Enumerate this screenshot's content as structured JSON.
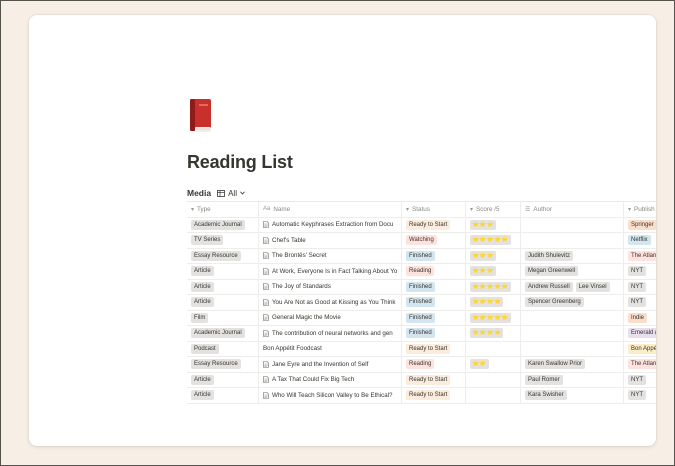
{
  "page": {
    "title": "Reading List",
    "icon": "red-book-icon"
  },
  "database": {
    "title": "Media",
    "view_label": "All"
  },
  "columns": [
    {
      "label": "Type",
      "icon": "select-icon"
    },
    {
      "label": "Name",
      "icon": "text-icon"
    },
    {
      "label": "Status",
      "icon": "select-icon"
    },
    {
      "label": "Score /5",
      "icon": "select-icon"
    },
    {
      "label": "Author",
      "icon": "multi-select-icon"
    },
    {
      "label": "Publish",
      "icon": "select-icon"
    }
  ],
  "rows": [
    {
      "type": "Academic Journal",
      "name": "Automatic Keyphrases Extraction from Docu",
      "status": "Ready to Start",
      "status_class": "st-ready",
      "score": "⭐⭐⭐",
      "authors": [],
      "publisher": "Springer",
      "pub_class": "pub-springer",
      "doc": true
    },
    {
      "type": "TV Series",
      "name": "Chef's Table",
      "status": "Watching",
      "status_class": "st-watching",
      "score": "⭐⭐⭐⭐⭐",
      "authors": [],
      "publisher": "Netflix",
      "pub_class": "pub-netflix",
      "doc": true
    },
    {
      "type": "Essay Resource",
      "name": "The Brontës' Secret",
      "status": "Finished",
      "status_class": "st-finished",
      "score": "⭐⭐⭐",
      "authors": [
        "Judith Shulevitz"
      ],
      "publisher": "The Atlan",
      "pub_class": "pub-atlantic",
      "doc": true
    },
    {
      "type": "Article",
      "name": "At Work, Everyone Is in Fact Talking About Yo",
      "status": "Reading",
      "status_class": "st-reading",
      "score": "⭐⭐⭐",
      "authors": [
        "Megan Greenwell"
      ],
      "publisher": "NYT",
      "pub_class": "pub-nyt",
      "doc": true
    },
    {
      "type": "Article",
      "name": "The Joy of Standards",
      "status": "Finished",
      "status_class": "st-finished",
      "score": "⭐⭐⭐⭐⭐",
      "authors": [
        "Andrew Russell",
        "Lee Vinsel"
      ],
      "publisher": "NYT",
      "pub_class": "pub-nyt",
      "doc": true
    },
    {
      "type": "Article",
      "name": "You Are Not as Good at Kissing as You Think",
      "status": "Finished",
      "status_class": "st-finished",
      "score": "⭐⭐⭐⭐",
      "authors": [
        "Spencer Greenberg"
      ],
      "publisher": "NYT",
      "pub_class": "pub-nyt",
      "doc": true
    },
    {
      "type": "Film",
      "name": "General Magic the Movie",
      "status": "Finished",
      "status_class": "st-finished",
      "score": "⭐⭐⭐⭐⭐",
      "authors": [],
      "publisher": "Indie",
      "pub_class": "pub-indie",
      "doc": true
    },
    {
      "type": "Academic Journal",
      "name": "The contribution of neural networks and gen",
      "status": "Finished",
      "status_class": "st-finished",
      "score": "⭐⭐⭐⭐",
      "authors": [],
      "publisher": "Emerald (",
      "pub_class": "pub-emerald",
      "doc": true
    },
    {
      "type": "Podcast",
      "name": "Bon Appétit Foodcast",
      "status": "Ready to Start",
      "status_class": "st-ready",
      "score": "",
      "authors": [],
      "publisher": "Bon Appé",
      "pub_class": "pub-bonapp",
      "doc": false
    },
    {
      "type": "Essay Resource",
      "name": "Jane Eyre and the Invention of Self",
      "status": "Reading",
      "status_class": "st-reading",
      "score": "⭐⭐",
      "authors": [
        "Karen Swallow Prior"
      ],
      "publisher": "The Atlan",
      "pub_class": "pub-atlantic",
      "doc": true
    },
    {
      "type": "Article",
      "name": "A Tax That Could Fix Big Tech",
      "status": "Ready to Start",
      "status_class": "st-ready",
      "score": "",
      "authors": [
        "Paul Romer"
      ],
      "publisher": "NYT",
      "pub_class": "pub-nyt",
      "doc": true
    },
    {
      "type": "Article",
      "name": "Who Will Teach Silicon Valley to Be Ethical?",
      "status": "Ready to Start",
      "status_class": "st-ready",
      "score": "",
      "authors": [
        "Kara Swisher"
      ],
      "publisher": "NYT",
      "pub_class": "pub-nyt",
      "doc": true
    }
  ]
}
